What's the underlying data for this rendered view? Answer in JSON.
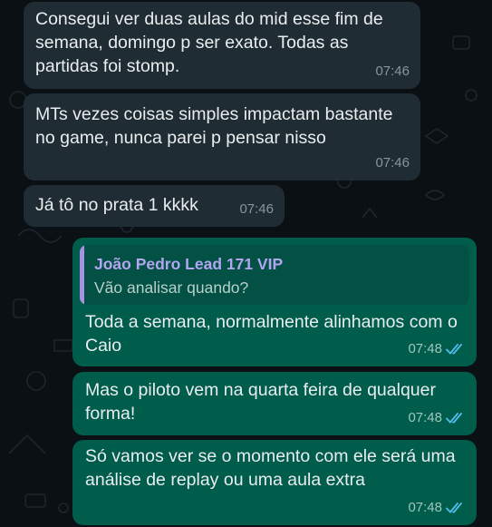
{
  "messages": [
    {
      "text": "Consegui ver duas aulas do mid esse fim de semana, domingo p ser exato. Todas as partidas foi stomp.",
      "time": "07:46",
      "direction": "in"
    },
    {
      "text": "MTs vezes coisas simples impactam bastante no game, nunca parei p pensar nisso",
      "time": "07:46",
      "direction": "in"
    },
    {
      "text": "Já tô no prata 1 kkkk",
      "time": "07:46",
      "direction": "in"
    },
    {
      "quote": {
        "author": "João Pedro Lead 171 VIP",
        "text": "Vão analisar quando?"
      },
      "text": "Toda a semana, normalmente alinhamos com o Caio",
      "time": "07:48",
      "direction": "out",
      "status": "read"
    },
    {
      "text": "Mas o piloto vem na quarta feira de qualquer forma!",
      "time": "07:48",
      "direction": "out",
      "status": "read"
    },
    {
      "text": "Só vamos ver se o momento com ele será uma análise de replay ou uma aula extra",
      "time": "07:48",
      "direction": "out",
      "status": "read"
    }
  ],
  "colors": {
    "background": "#0b1014",
    "incoming_bubble": "#202c33",
    "outgoing_bubble": "#005c4b",
    "read_ticks": "#53bdeb",
    "quote_author": "#b3a5f0"
  },
  "icons": {
    "read_status": "double-check-icon",
    "wallpaper": "doodle-pattern"
  }
}
